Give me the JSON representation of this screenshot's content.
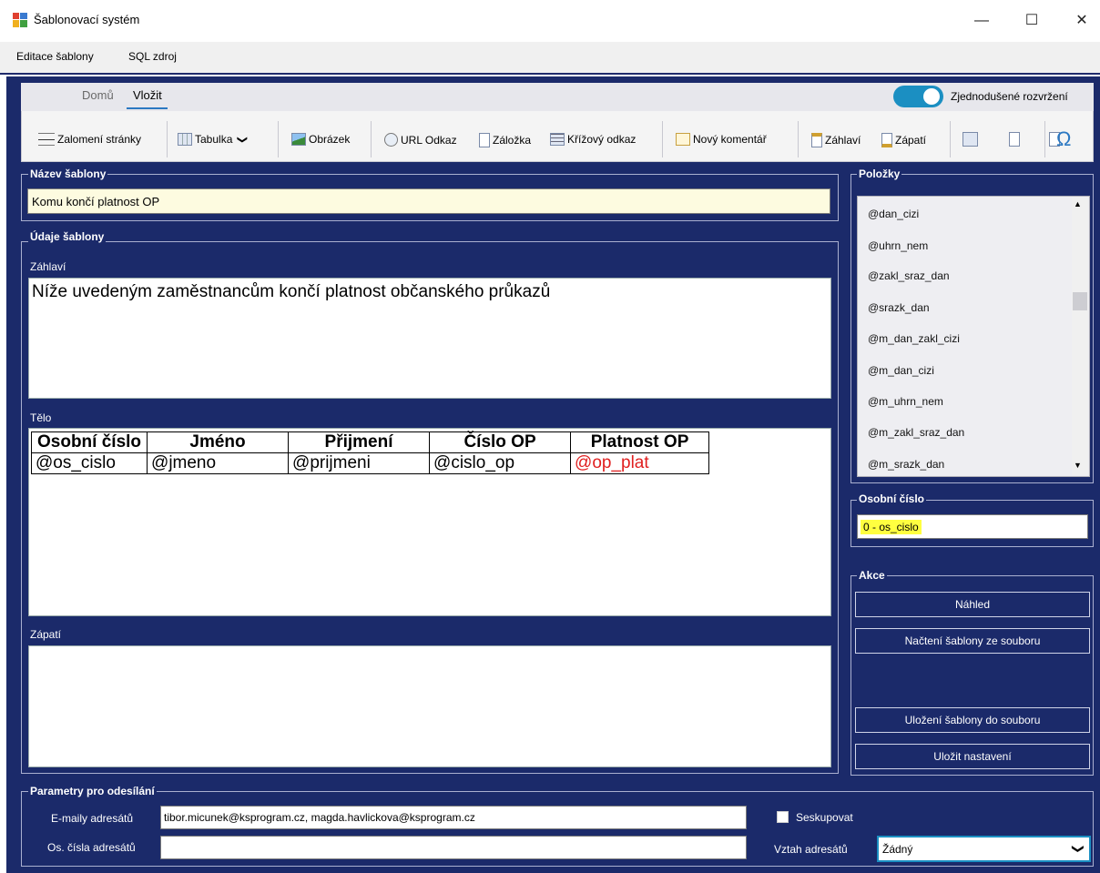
{
  "window": {
    "title": "Šablonovací systém",
    "minimize": "—",
    "maximize": "☐",
    "close": "✕"
  },
  "menu": {
    "items": [
      "Editace šablony",
      "SQL zdroj"
    ]
  },
  "ribbon": {
    "tabs": [
      "Domů",
      "Vložit"
    ],
    "toggle_label": "Zjednodušené rozvržení",
    "toggle_on": true,
    "buttons": [
      "Zalomení stránky",
      "Tabulka",
      "Obrázek",
      "URL Odkaz",
      "Záložka",
      "Křížový odkaz",
      "Nový komentář",
      "Záhlaví",
      "Zápatí"
    ],
    "chevron": "❯",
    "omega": "Ω"
  },
  "template_name": {
    "label": "Název šablony",
    "value": "Komu končí platnost OP"
  },
  "template_data": {
    "label": "Údaje šablony",
    "header_label": "Záhlaví",
    "header_text": "Níže uvedeným zaměstnancům končí platnost občanského průkazů",
    "body_label": "Tělo",
    "footer_label": "Zápatí",
    "table": {
      "headers": [
        "Osobní číslo",
        "Jméno",
        "Přijmení",
        "Číslo OP",
        "Platnost OP"
      ],
      "row": [
        "@os_cislo",
        "@jmeno",
        "@prijmeni",
        "@cislo_op",
        "@op_plat"
      ],
      "highlight_color": "#e02020"
    }
  },
  "items": {
    "label": "Položky",
    "list": [
      "@dan_cizi",
      "@uhrn_nem",
      "@zakl_sraz_dan",
      "@srazk_dan",
      "@m_dan_zakl_cizi",
      "@m_dan_cizi",
      "@m_uhrn_nem",
      "@m_zakl_sraz_dan",
      "@m_srazk_dan"
    ],
    "scroll_up": "▲",
    "scroll_down": "▼"
  },
  "personal_number": {
    "label": "Osobní číslo",
    "value": "0 - os_cislo"
  },
  "actions": {
    "label": "Akce",
    "preview": "Náhled",
    "load": "Načtení šablony ze souboru",
    "save_file": "Uložení šablony do souboru",
    "save_settings": "Uložit nastavení"
  },
  "send_params": {
    "label": "Parametry pro odesílání",
    "emails_label": "E-maily adresátů",
    "emails_value": "tibor.micunek@ksprogram.cz, magda.havlickova@ksprogram.cz",
    "numbers_label": "Os. čísla adresátů",
    "numbers_value": "",
    "group_label": "Seskupovat",
    "relation_label": "Vztah adresátů",
    "relation_value": "Žádný"
  }
}
